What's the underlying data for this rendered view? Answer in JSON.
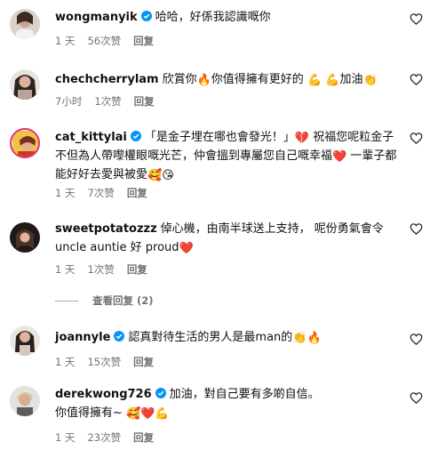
{
  "reply_label": "回复",
  "view_replies": "查看回复 (2)",
  "colors": {
    "verified": "#0095f6",
    "meta": "#737373",
    "heart_red": "#e0243a"
  },
  "comments": [
    {
      "username": "wongmanyik",
      "verified": true,
      "lines": [
        "哈哈，好係我認識嘅你"
      ],
      "time": "1 天",
      "likes": "56次赞",
      "reply": "回复"
    },
    {
      "username": "chechcherrylam",
      "verified": false,
      "lines": [
        "欣賞你",
        "你值得擁有更好的",
        "加油"
      ],
      "emojis": [
        "🔥",
        "💪",
        "💪",
        "👏"
      ],
      "time": "7小时",
      "likes": "1次赞",
      "reply": "回复"
    },
    {
      "username": "cat_kittylai",
      "verified": true,
      "lines": [
        "「是金子埋在哪也會發光！」",
        "祝福您呢粒金子",
        "不但為人帶嚟權眼嘅光芒，仲會搵到專屬您自己嘅幸福",
        "一輩",
        "子都能好好去愛與被愛"
      ],
      "emojis": [
        "💔",
        "❤️",
        "🥰",
        "😘"
      ],
      "time": "1 天",
      "likes": "7次赞",
      "reply": "回复"
    },
    {
      "username": "sweetpotatozzz",
      "verified": false,
      "lines": [
        "倬心機，由南半球送上支持， 呢份勇氣會令",
        "uncle auntie 好 proud"
      ],
      "emojis": [
        "❤️"
      ],
      "time": "1 天",
      "likes": "1次赞",
      "reply": "回复"
    },
    {
      "username": "joannyle",
      "verified": true,
      "lines": [
        "認真對待生活的男人是最man的"
      ],
      "emojis": [
        "👏",
        "🔥"
      ],
      "time": "1 天",
      "likes": "15次赞",
      "reply": "回复"
    },
    {
      "username": "derekwong726",
      "verified": true,
      "lines": [
        "加油，對自己要有多啲自信。",
        "你值得擁有~"
      ],
      "emojis": [
        "🥰",
        "❤️",
        "💪"
      ],
      "time": "1 天",
      "likes": "23次赞",
      "reply": "回复"
    }
  ]
}
